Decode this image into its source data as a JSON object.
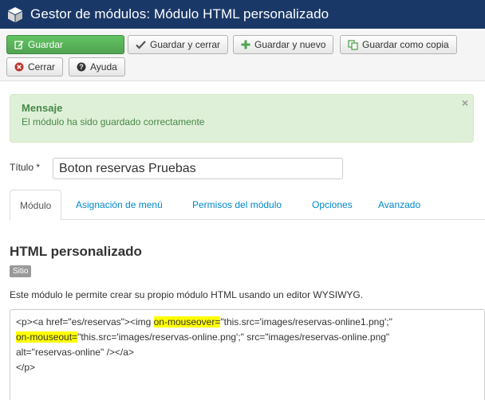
{
  "header": {
    "title": "Gestor de módulos: Módulo HTML personalizado"
  },
  "toolbar": {
    "save": "Guardar",
    "save_close": "Guardar y cerrar",
    "save_new": "Guardar y nuevo",
    "save_copy": "Guardar como copia",
    "close": "Cerrar",
    "help": "Ayuda"
  },
  "alert": {
    "heading": "Mensaje",
    "text": "El módulo ha sido guardado correctamente",
    "close_glyph": "×"
  },
  "form": {
    "title_label": "Título *",
    "title_value": "Boton reservas Pruebas"
  },
  "tabs": [
    {
      "label": "Módulo",
      "active": true
    },
    {
      "label": "Asignación de menú",
      "active": false
    },
    {
      "label": "Permisos del módulo",
      "active": false
    },
    {
      "label": "Opciones",
      "active": false
    },
    {
      "label": "Avanzado",
      "active": false
    }
  ],
  "content": {
    "heading": "HTML personalizado",
    "badge": "Sitio",
    "description": "Este módulo le permite crear su propio módulo HTML usando un editor WYSIWYG."
  },
  "editor": {
    "line1_a": "<p><a href=\"es/reservas\"><img ",
    "line1_hl": "on-mouseover=",
    "line1_b": "\"this.src='images/reservas-online1.png';\"",
    "line2_hl": "on-mouseout=",
    "line2_b": "\"this.src='images/reservas-online.png';\" src=\"images/reservas-online.png\"",
    "line3": "alt=\"reservas-online\" /></a>",
    "line4": "</p>"
  },
  "colors": {
    "header_bg": "#1a3867",
    "success": "#51a351",
    "alert_bg": "#dff0d8",
    "alert_text": "#468847",
    "link": "#0088cc",
    "highlight": "#ffff00"
  },
  "icons": [
    "joomla-cube-icon",
    "edit-icon",
    "check-icon",
    "plus-icon",
    "copy-icon",
    "cancel-circle-icon",
    "help-icon"
  ]
}
